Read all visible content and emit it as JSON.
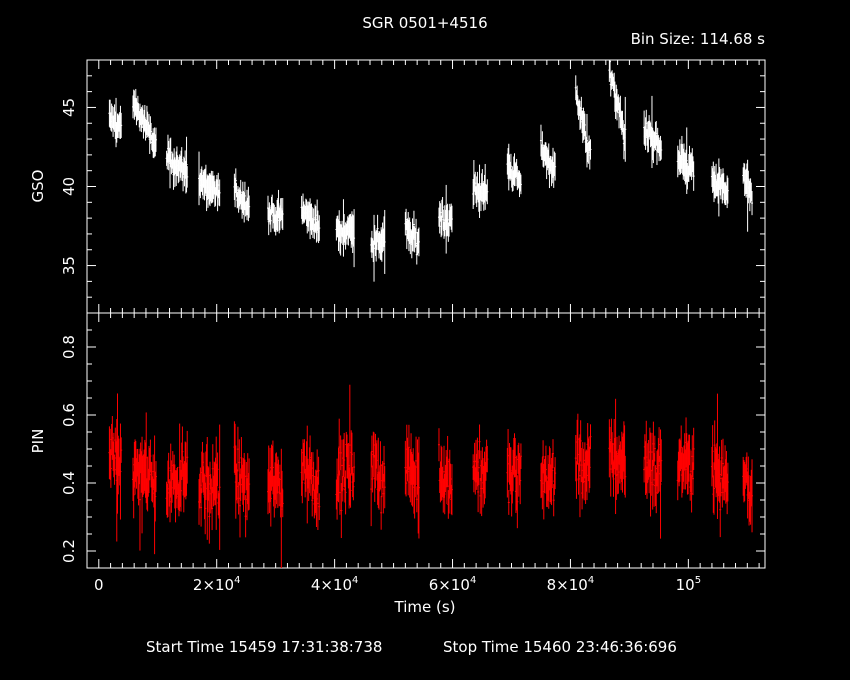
{
  "title": "SGR 0501+4516",
  "bin_size_label": "Bin Size: 114.68 s",
  "start_time": "Start Time 15459 17:31:38:738",
  "stop_time": "Stop Time 15460 23:46:36:696",
  "colors": {
    "background": "#000000",
    "frame": "#ffffff",
    "gso": "#ffffff",
    "pin": "#ff0000"
  },
  "chart_data": [
    {
      "type": "scatter",
      "panel": "top",
      "ylabel": "GSO",
      "ylim": [
        32,
        48
      ],
      "yticks": [
        35,
        40,
        45
      ],
      "xlim": [
        -2000,
        113000
      ],
      "series": [
        {
          "color": "#ffffff",
          "segments": [
            {
              "x": [
                1800,
                3800
              ],
              "y": [
                44.3,
                43.7
              ]
            },
            {
              "x": [
                5800,
                9700
              ],
              "y": [
                45.4,
                42.5
              ]
            },
            {
              "x": [
                11500,
                15000
              ],
              "y": [
                41.8,
                40.9
              ]
            },
            {
              "x": [
                17000,
                20500
              ],
              "y": [
                40.4,
                39.5
              ]
            },
            {
              "x": [
                23000,
                25500
              ],
              "y": [
                39.7,
                38.8
              ]
            },
            {
              "x": [
                28700,
                31200
              ],
              "y": [
                38.3,
                38.0
              ]
            },
            {
              "x": [
                34400,
                37400
              ],
              "y": [
                38.6,
                37.4
              ]
            },
            {
              "x": [
                40300,
                43300
              ],
              "y": [
                37.1,
                37.3
              ]
            },
            {
              "x": [
                46200,
                48500
              ],
              "y": [
                36.3,
                36.8
              ]
            },
            {
              "x": [
                52000,
                54300
              ],
              "y": [
                37.3,
                36.4
              ]
            },
            {
              "x": [
                57700,
                59900
              ],
              "y": [
                38.2,
                37.8
              ]
            },
            {
              "x": [
                63500,
                65900
              ],
              "y": [
                40.0,
                39.5
              ]
            },
            {
              "x": [
                69300,
                71600
              ],
              "y": [
                41.5,
                40.0
              ]
            },
            {
              "x": [
                75000,
                77400
              ],
              "y": [
                42.4,
                41.0
              ]
            },
            {
              "x": [
                80900,
                83400
              ],
              "y": [
                46.0,
                41.8
              ]
            },
            {
              "x": [
                86600,
                89300
              ],
              "y": [
                47.5,
                43.0
              ]
            },
            {
              "x": [
                92500,
                95400
              ],
              "y": [
                43.7,
                42.3
              ]
            },
            {
              "x": [
                98200,
                100900
              ],
              "y": [
                41.6,
                41.1
              ]
            },
            {
              "x": [
                104000,
                106700
              ],
              "y": [
                40.3,
                39.7
              ]
            },
            {
              "x": [
                109300,
                110800
              ],
              "y": [
                40.6,
                39.1
              ]
            }
          ]
        }
      ]
    },
    {
      "type": "scatter",
      "panel": "bottom",
      "xlabel": "Time (s)",
      "ylabel": "PIN",
      "ylim": [
        0.15,
        0.9
      ],
      "yticks": [
        0.2,
        0.4,
        0.6,
        0.8
      ],
      "xlim": [
        -2000,
        113000
      ],
      "xticks": [
        0,
        20000,
        40000,
        60000,
        80000,
        100000
      ],
      "series": [
        {
          "color": "#ff0000",
          "segments": [
            {
              "x": [
                1800,
                3800
              ],
              "y": [
                0.47,
                0.47
              ]
            },
            {
              "x": [
                5800,
                9700
              ],
              "y": [
                0.43,
                0.41
              ]
            },
            {
              "x": [
                11500,
                15000
              ],
              "y": [
                0.38,
                0.45
              ]
            },
            {
              "x": [
                17000,
                20500
              ],
              "y": [
                0.4,
                0.38
              ]
            },
            {
              "x": [
                23000,
                25500
              ],
              "y": [
                0.42,
                0.37
              ]
            },
            {
              "x": [
                28700,
                31200
              ],
              "y": [
                0.42,
                0.38
              ]
            },
            {
              "x": [
                34400,
                37400
              ],
              "y": [
                0.44,
                0.4
              ]
            },
            {
              "x": [
                40300,
                43300
              ],
              "y": [
                0.41,
                0.44
              ]
            },
            {
              "x": [
                46200,
                48500
              ],
              "y": [
                0.44,
                0.4
              ]
            },
            {
              "x": [
                52000,
                54300
              ],
              "y": [
                0.46,
                0.4
              ]
            },
            {
              "x": [
                57700,
                59900
              ],
              "y": [
                0.44,
                0.4
              ]
            },
            {
              "x": [
                63500,
                65900
              ],
              "y": [
                0.44,
                0.42
              ]
            },
            {
              "x": [
                69300,
                71600
              ],
              "y": [
                0.42,
                0.42
              ]
            },
            {
              "x": [
                75000,
                77400
              ],
              "y": [
                0.42,
                0.42
              ]
            },
            {
              "x": [
                80900,
                83400
              ],
              "y": [
                0.46,
                0.44
              ]
            },
            {
              "x": [
                86600,
                89300
              ],
              "y": [
                0.48,
                0.47
              ]
            },
            {
              "x": [
                92500,
                95400
              ],
              "y": [
                0.46,
                0.44
              ]
            },
            {
              "x": [
                98200,
                100900
              ],
              "y": [
                0.46,
                0.47
              ]
            },
            {
              "x": [
                104000,
                106700
              ],
              "y": [
                0.45,
                0.4
              ]
            },
            {
              "x": [
                109300,
                110800
              ],
              "y": [
                0.46,
                0.38
              ]
            }
          ]
        }
      ]
    }
  ]
}
